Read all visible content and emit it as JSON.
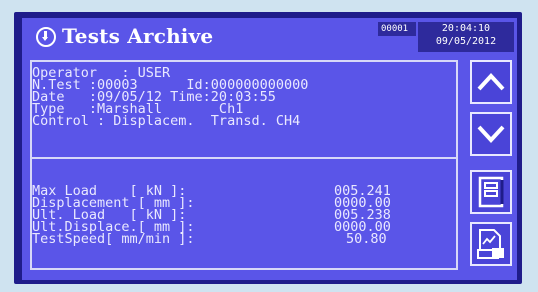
{
  "header": {
    "title": "Tests Archive",
    "record_id": "00001",
    "time": "20:04:10",
    "date": "09/05/2012"
  },
  "info": {
    "operator_row": "Operator   : USER",
    "ntest_row": "N.Test :00003      Id:000000000000",
    "date_row": "Date   :09/05/12 Time:20:03:55",
    "type_row": "Type   :Marshall       Ch1",
    "control_row": "Control : Displacem.  Transd. CH4"
  },
  "results": {
    "rows": [
      {
        "label": "Max Load    [ kN ]:",
        "value": "005.241"
      },
      {
        "label": "Displacement [ mm ]:",
        "value": "0000.00"
      },
      {
        "label": "Ult. Load   [ kN ]:",
        "value": "005.238"
      },
      {
        "label": "Ult.Displace.[ mm ]:",
        "value": "0000.00"
      },
      {
        "label": "TestSpeed[ mm/min ]:",
        "value": "50.80"
      }
    ]
  },
  "icons": {
    "up": "chevron-up-icon",
    "down": "chevron-down-icon",
    "memory": "memory-card-icon",
    "print": "print-report-icon"
  },
  "colors": {
    "screen": "#5a55e8",
    "text": "#e9e8ff",
    "bezel": "#1f1c8a"
  }
}
